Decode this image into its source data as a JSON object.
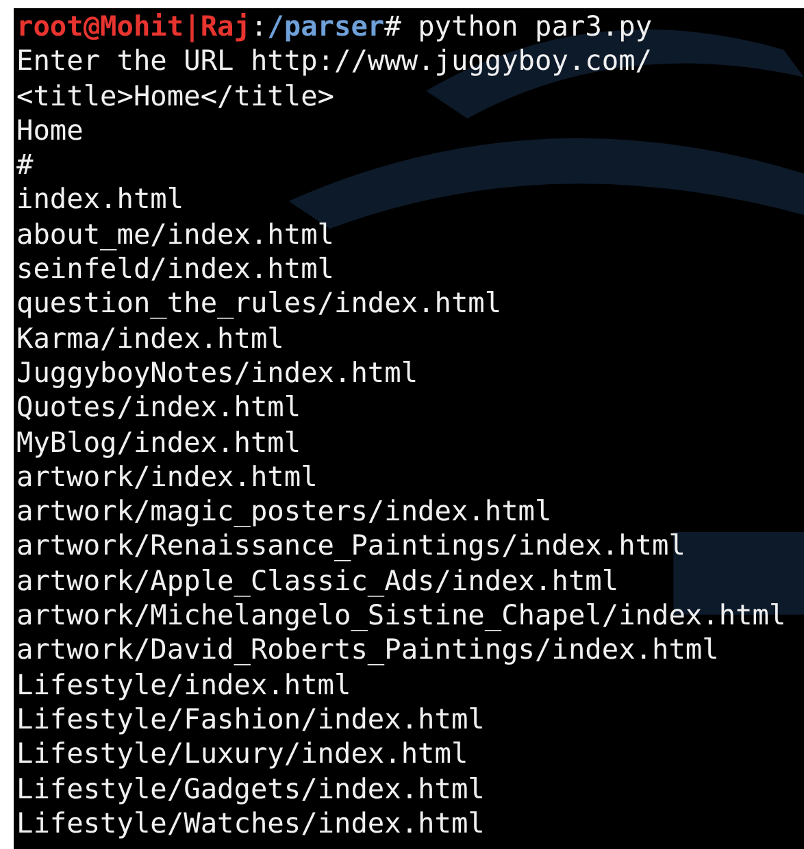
{
  "terminal": {
    "prompt": [
      {
        "kind": "user",
        "text": "root@Mohit|Raj"
      },
      {
        "kind": "plain",
        "text": ":"
      },
      {
        "kind": "path",
        "text": "/parser"
      },
      {
        "kind": "plain",
        "text": "#"
      }
    ],
    "command": "python par3.py",
    "output": [
      "Enter the URL http://www.juggyboy.com/",
      "<title>Home</title>",
      "Home",
      "#",
      "index.html",
      "about_me/index.html",
      "seinfeld/index.html",
      "question_the_rules/index.html",
      "Karma/index.html",
      "JuggyboyNotes/index.html",
      "Quotes/index.html",
      "MyBlog/index.html",
      "artwork/index.html",
      "artwork/magic_posters/index.html",
      "artwork/Renaissance_Paintings/index.html",
      "artwork/Apple_Classic_Ads/index.html",
      "artwork/Michelangelo_Sistine_Chapel/index.html",
      "artwork/David_Roberts_Paintings/index.html",
      "Lifestyle/index.html",
      "Lifestyle/Fashion/index.html",
      "Lifestyle/Luxury/index.html",
      "Lifestyle/Gadgets/index.html",
      "Lifestyle/Watches/index.html"
    ]
  }
}
